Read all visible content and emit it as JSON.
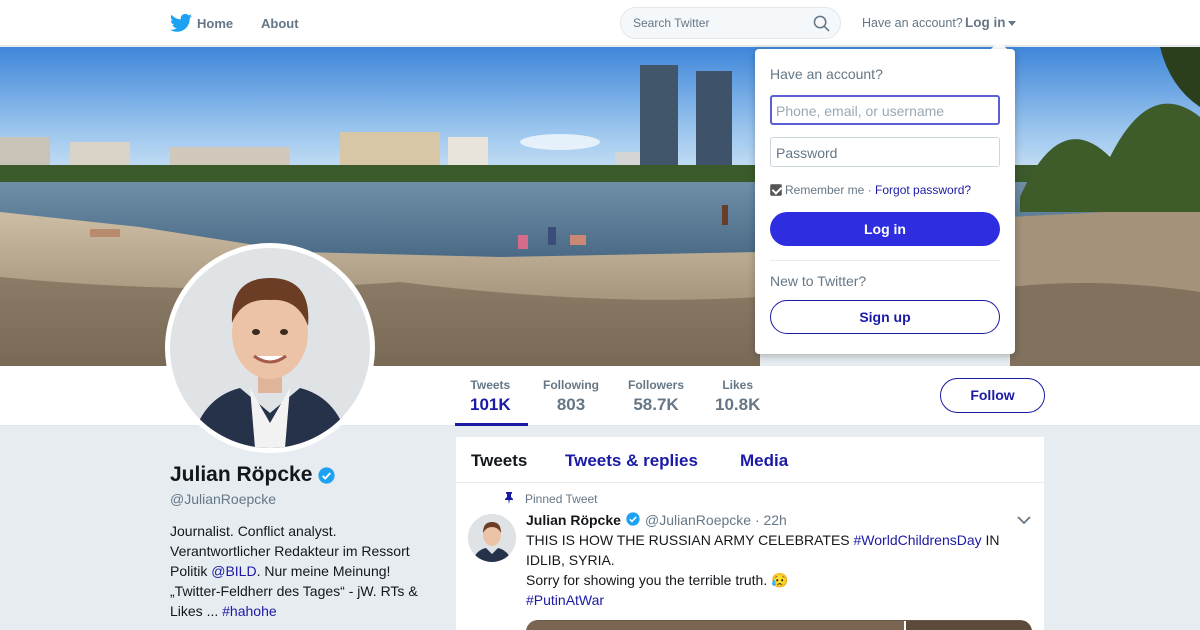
{
  "nav": {
    "home_label": "Home",
    "about_label": "About",
    "search_placeholder": "Search Twitter",
    "have_account": "Have an account?",
    "login_label": "Log in"
  },
  "profile": {
    "name": "Julian Röpcke",
    "handle": "@JulianRoepcke",
    "bio_line1": "Journalist. Conflict analyst.",
    "bio_line2": "Verantwortlicher Redakteur im Ressort",
    "bio_line3_pre": "Politik ",
    "bio_mention": "@BILD",
    "bio_line3_post": ". Nur meine Meinung!",
    "bio_line4": "„Twitter-Feldherr des Tages“ - jW. RTs &",
    "bio_line5_pre": "Likes ... ",
    "bio_hashtag": "#hahohe",
    "follow_label": "Follow"
  },
  "stats": [
    {
      "label": "Tweets",
      "value": "101K"
    },
    {
      "label": "Following",
      "value": "803"
    },
    {
      "label": "Followers",
      "value": "58.7K"
    },
    {
      "label": "Likes",
      "value": "10.8K"
    }
  ],
  "timeline": {
    "tabs": [
      "Tweets",
      "Tweets & replies",
      "Media"
    ],
    "pinned_label": "Pinned Tweet",
    "tweet": {
      "name": "Julian Röpcke",
      "handle": "@JulianRoepcke",
      "time": "· 22h",
      "text_pre": "THIS IS HOW THE RUSSIAN ARMY CELEBRATES ",
      "hashtag1": "#WorldChildrensDay",
      "text_mid": " IN IDLIB, SYRIA.",
      "text_line2": "Sorry for showing you the terrible truth. 😥",
      "hashtag2": "#PutinAtWar"
    }
  },
  "login_dropdown": {
    "title": "Have an account?",
    "username_placeholder": "Phone, email, or username",
    "password_placeholder": "Password",
    "remember_label": "Remember me",
    "separator": " · ",
    "forgot_label": "Forgot password?",
    "login_button": "Log in",
    "new_label": "New to Twitter?",
    "signup_button": "Sign up"
  },
  "colors": {
    "accent": "#1a1aa6",
    "twitter_blue": "#1da1f2",
    "button_fill": "#2e2ee0"
  }
}
